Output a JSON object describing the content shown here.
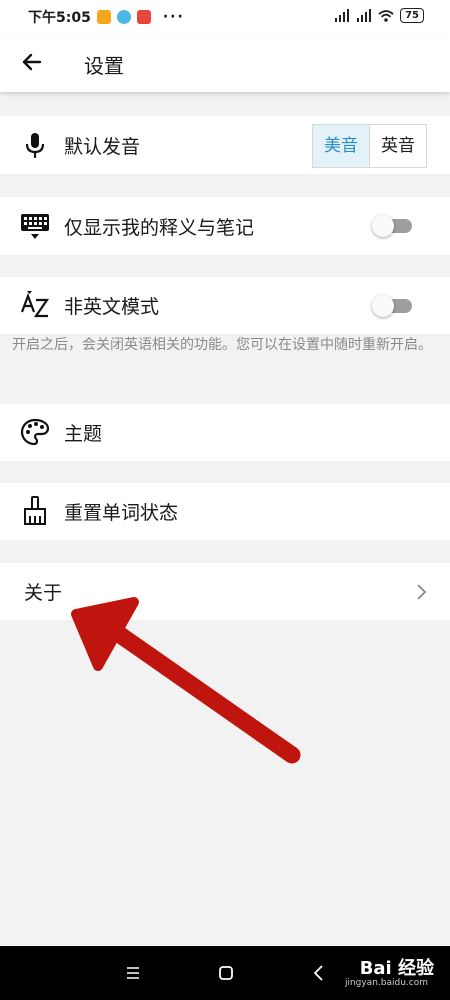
{
  "status_bar": {
    "time": "下午5:05",
    "more": "···",
    "battery": "75"
  },
  "header": {
    "title": "设置"
  },
  "settings": {
    "pronunciation": {
      "label": "默认发音",
      "options": [
        "美音",
        "英音"
      ],
      "selected": "美音"
    },
    "only_my_notes": {
      "label": "仅显示我的释义与笔记",
      "enabled": false
    },
    "non_english_mode": {
      "label": "非英文模式",
      "enabled": false,
      "description": "开启之后，会关闭英语相关的功能。您可以在设置中随时重新开启。"
    },
    "theme": {
      "label": "主题"
    },
    "reset_word_status": {
      "label": "重置单词状态"
    },
    "about": {
      "label": "关于"
    }
  },
  "watermark": {
    "brand": "Bai 经验",
    "url": "jingyan.baidu.com"
  },
  "colors": {
    "accent": "#2a8fc4",
    "annotation_arrow": "#c0150f"
  }
}
